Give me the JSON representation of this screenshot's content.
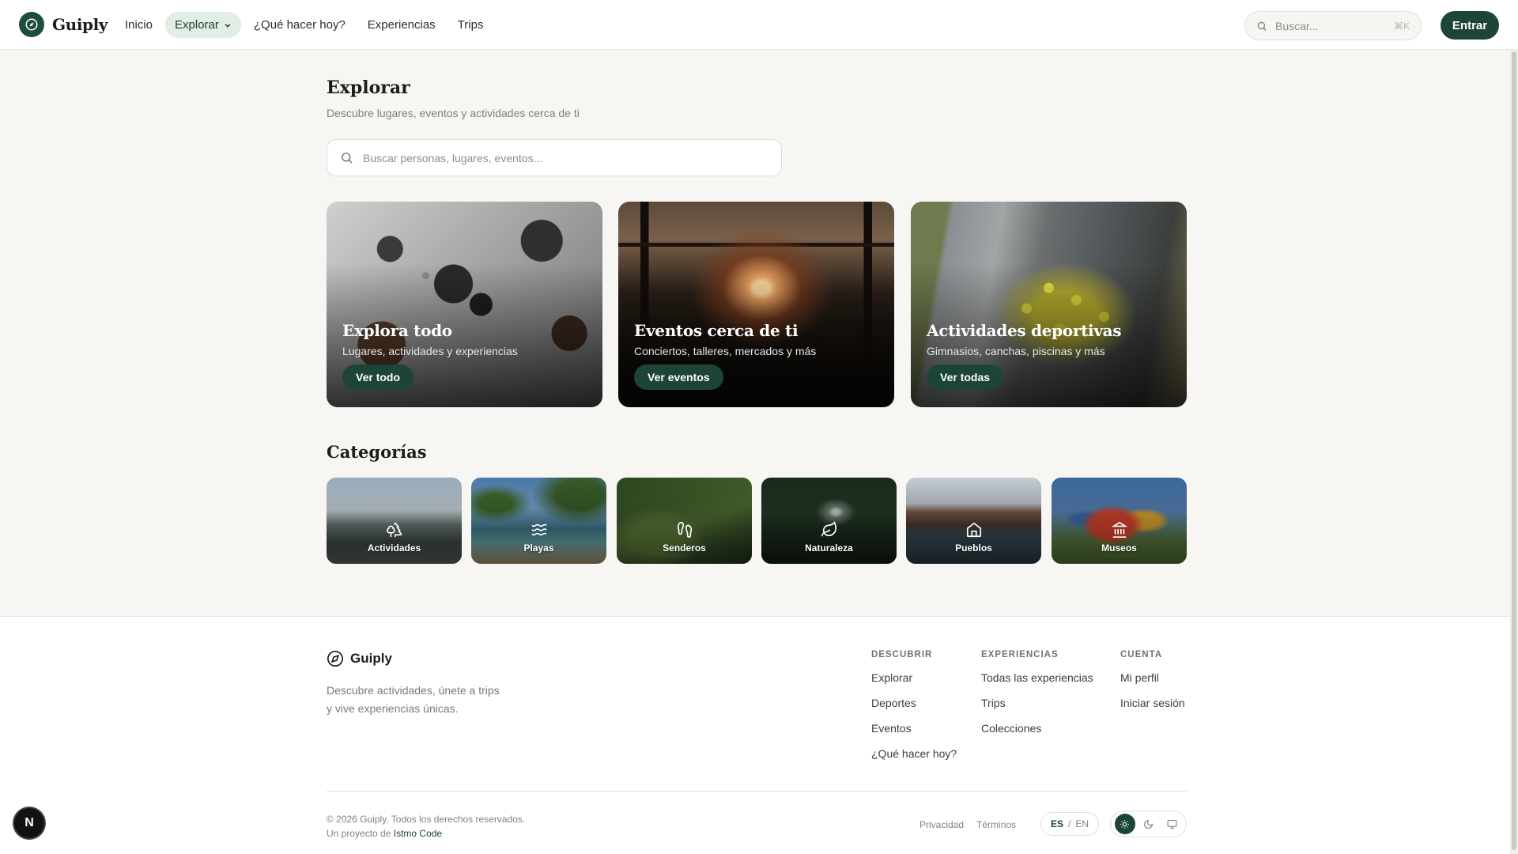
{
  "header": {
    "brand": "Guiply",
    "nav": [
      {
        "label": "Inicio"
      },
      {
        "label": "Explorar"
      },
      {
        "label": "¿Qué hacer hoy?"
      },
      {
        "label": "Experiencias"
      },
      {
        "label": "Trips"
      }
    ],
    "search_placeholder": "Buscar...",
    "search_shortcut": "⌘K",
    "login_label": "Entrar"
  },
  "main": {
    "title": "Explorar",
    "subtitle": "Descubre lugares, eventos y actividades cerca de ti",
    "search_placeholder": "Buscar personas, lugares, eventos...",
    "hero_cards": [
      {
        "title": "Explora todo",
        "subtitle": "Lugares, actividades y experiencias",
        "button": "Ver todo"
      },
      {
        "title": "Eventos cerca de ti",
        "subtitle": "Conciertos, talleres, mercados y más",
        "button": "Ver eventos"
      },
      {
        "title": "Actividades deportivas",
        "subtitle": "Gimnasios, canchas, piscinas y más",
        "button": "Ver todas"
      }
    ],
    "categories_title": "Categorías",
    "categories": [
      {
        "label": "Actividades",
        "icon": "trees-icon"
      },
      {
        "label": "Playas",
        "icon": "waves-icon"
      },
      {
        "label": "Senderos",
        "icon": "footprints-icon"
      },
      {
        "label": "Naturaleza",
        "icon": "leaf-icon"
      },
      {
        "label": "Pueblos",
        "icon": "home-icon"
      },
      {
        "label": "Museos",
        "icon": "landmark-icon"
      }
    ]
  },
  "footer": {
    "brand": "Guiply",
    "description": "Descubre actividades, únete a trips y vive experiencias únicas.",
    "columns": [
      {
        "heading": "DESCUBRIR",
        "links": [
          "Explorar",
          "Deportes",
          "Eventos",
          "¿Qué hacer hoy?"
        ]
      },
      {
        "heading": "EXPERIENCIAS",
        "links": [
          "Todas las experiencias",
          "Trips",
          "Colecciones"
        ]
      },
      {
        "heading": "CUENTA",
        "links": [
          "Mi perfil",
          "Iniciar sesión"
        ]
      }
    ],
    "copyright": "© 2026 Guiply. Todos los derechos reservados.",
    "project_prefix": "Un proyecto de",
    "project_brand": "Istmo Code",
    "legal": [
      "Privacidad",
      "Términos"
    ],
    "lang_active": "ES",
    "lang_sep": "/",
    "lang_other": "EN"
  },
  "dev_badge": "N",
  "colors": {
    "primary": "#1d4535",
    "active_nav_bg": "#e2ede6",
    "page_bg": "#f7f6f3"
  }
}
